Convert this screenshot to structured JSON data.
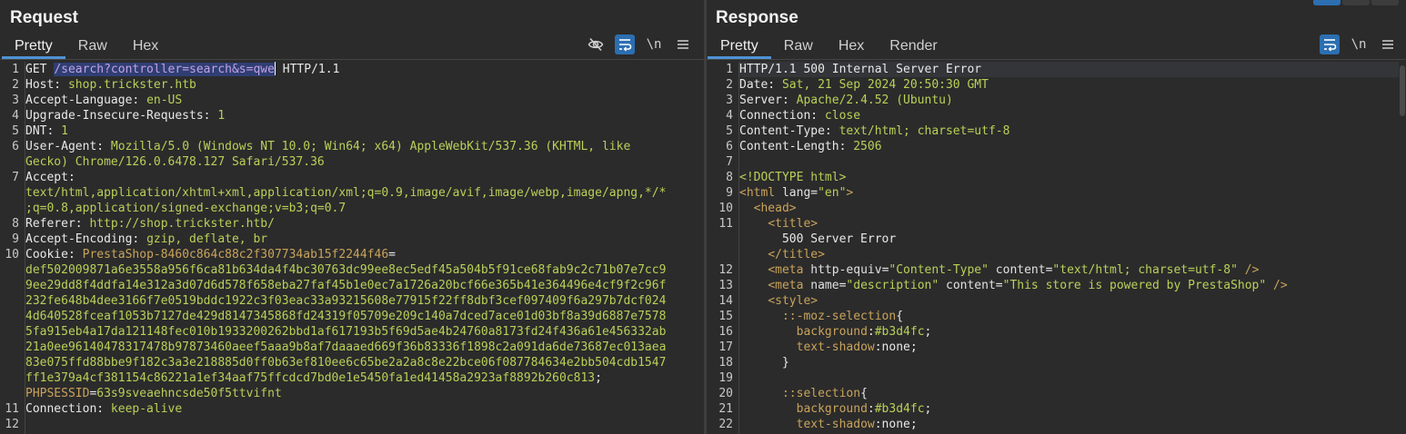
{
  "request": {
    "title": "Request",
    "tabs": [
      "Pretty",
      "Raw",
      "Hex"
    ],
    "active_tab": "Pretty",
    "tools": {
      "hide_icon": "eye-slash-icon",
      "wrap_icon": "wrap-lines-icon",
      "newline_label": "\\n",
      "menu_icon": "hamburger-menu-icon"
    },
    "line_numbers": [
      "1",
      "2",
      "3",
      "4",
      "5",
      "6",
      "",
      "7",
      "",
      "",
      "8",
      "9",
      "10",
      "",
      "",
      "",
      "",
      "",
      "",
      "",
      "",
      "",
      "11",
      "12"
    ],
    "lines": [
      [
        {
          "c": "k",
          "t": "GET "
        },
        {
          "c": "hl",
          "t": "/search?controller=search&s=qwe"
        },
        {
          "c": "caret",
          "t": ""
        },
        {
          "c": "k",
          "t": " HTTP/1.1"
        }
      ],
      [
        {
          "c": "k",
          "t": "Host: "
        },
        {
          "c": "v",
          "t": "shop.trickster.htb"
        }
      ],
      [
        {
          "c": "k",
          "t": "Accept-Language: "
        },
        {
          "c": "v",
          "t": "en-US"
        }
      ],
      [
        {
          "c": "k",
          "t": "Upgrade-Insecure-Requests: "
        },
        {
          "c": "v",
          "t": "1"
        }
      ],
      [
        {
          "c": "k",
          "t": "DNT: "
        },
        {
          "c": "v",
          "t": "1"
        }
      ],
      [
        {
          "c": "k",
          "t": "User-Agent: "
        },
        {
          "c": "v",
          "t": "Mozilla/5.0 (Windows NT 10.0; Win64; x64) AppleWebKit/537.36 (KHTML, like"
        }
      ],
      [
        {
          "c": "v",
          "t": "Gecko) Chrome/126.0.6478.127 Safari/537.36"
        }
      ],
      [
        {
          "c": "k",
          "t": "Accept:"
        }
      ],
      [
        {
          "c": "v",
          "t": "text/html,application/xhtml+xml,application/xml;q=0.9,image/avif,image/webp,image/apng,*/*"
        }
      ],
      [
        {
          "c": "v",
          "t": ";q=0.8,application/signed-exchange;v=b3;q=0.7"
        }
      ],
      [
        {
          "c": "k",
          "t": "Referer: "
        },
        {
          "c": "v",
          "t": "http://shop.trickster.htb/"
        }
      ],
      [
        {
          "c": "k",
          "t": "Accept-Encoding: "
        },
        {
          "c": "v",
          "t": "gzip, deflate, br"
        }
      ],
      [
        {
          "c": "k",
          "t": "Cookie: "
        },
        {
          "c": "t",
          "t": "PrestaShop-8460c864c88c2f307734ab15f2244f46"
        },
        {
          "c": "k",
          "t": "="
        }
      ],
      [
        {
          "c": "s",
          "t": "def502009871a6e3558a956f6ca81b634da4f4bc30763dc99ee8ec5edf45a504b5f91ce68fab9c2c71b07e7cc9"
        }
      ],
      [
        {
          "c": "s",
          "t": "9ee29dd8f4ddfa14e312a3d07d6d578f658eba27faf45b1e0ec7a1726a20bcf66e365b41e364496e4cf9f2c96f"
        }
      ],
      [
        {
          "c": "s",
          "t": "232fe648b4dee3166f7e0519bddc1922c3f03eac33a93215608e77915f22ff8dbf3cef097409f6a297b7dcf024"
        }
      ],
      [
        {
          "c": "s",
          "t": "4d640528fceaf1053b7127de429d8147345868fd24319f05709e209c140a7dced7ace01d03bf8a39d6887e7578"
        }
      ],
      [
        {
          "c": "s",
          "t": "5fa915eb4a17da121148fec010b1933200262bbd1af617193b5f69d5ae4b24760a8173fd24f436a61e456332ab"
        }
      ],
      [
        {
          "c": "s",
          "t": "21a0ee96140478317478b97873460aeef5aaa9b8af7daaaed669f36b83336f1898c2a091da6de73687ec013aea"
        }
      ],
      [
        {
          "c": "s",
          "t": "83e075ffd88bbe9f182c3a3e218885d0ff0b63ef810ee6c65be2a2a8c8e22bce06f087784634e2bb504cdb1547"
        }
      ],
      [
        {
          "c": "s",
          "t": "ff1e379a4cf381154c86221a1ef34aaf75ffcdcd7bd0e1e5450fa1ed41458a2923af8892b260c813"
        },
        {
          "c": "k",
          "t": ";"
        }
      ],
      [
        {
          "c": "t",
          "t": "PHPSESSID"
        },
        {
          "c": "k",
          "t": "="
        },
        {
          "c": "s",
          "t": "63s9sveaehncsde50f5ttvifnt"
        }
      ],
      [
        {
          "c": "k",
          "t": "Connection: "
        },
        {
          "c": "v",
          "t": "keep-alive"
        }
      ],
      []
    ]
  },
  "response": {
    "title": "Response",
    "tabs": [
      "Pretty",
      "Raw",
      "Hex",
      "Render"
    ],
    "active_tab": "Pretty",
    "tools": {
      "wrap_icon": "wrap-lines-icon",
      "newline_label": "\\n",
      "menu_icon": "hamburger-menu-icon"
    },
    "line_numbers": [
      "1",
      "2",
      "3",
      "4",
      "5",
      "6",
      "7",
      "8",
      "9",
      "10",
      "11",
      "",
      "",
      "12",
      "13",
      "14",
      "15",
      "16",
      "17",
      "18",
      "19",
      "20",
      "21",
      "22"
    ],
    "lines": [
      [
        {
          "c": "k",
          "t": "HTTP/1.1 500 Internal Server Error"
        }
      ],
      [
        {
          "c": "k",
          "t": "Date: "
        },
        {
          "c": "v",
          "t": "Sat, 21 Sep 2024 20:50:30 GMT"
        }
      ],
      [
        {
          "c": "k",
          "t": "Server: "
        },
        {
          "c": "v",
          "t": "Apache/2.4.52 (Ubuntu)"
        }
      ],
      [
        {
          "c": "k",
          "t": "Connection: "
        },
        {
          "c": "v",
          "t": "close"
        }
      ],
      [
        {
          "c": "k",
          "t": "Content-Type: "
        },
        {
          "c": "v",
          "t": "text/html; charset=utf-8"
        }
      ],
      [
        {
          "c": "k",
          "t": "Content-Length: "
        },
        {
          "c": "v",
          "t": "2506"
        }
      ],
      [],
      [
        {
          "c": "v",
          "t": "<!DOCTYPE html>"
        }
      ],
      [
        {
          "c": "t",
          "t": "<html "
        },
        {
          "c": "a",
          "t": "lang"
        },
        {
          "c": "k",
          "t": "="
        },
        {
          "c": "s",
          "t": "\"en\""
        },
        {
          "c": "t",
          "t": ">"
        }
      ],
      [
        {
          "c": "k",
          "t": "  "
        },
        {
          "c": "t",
          "t": "<head>"
        }
      ],
      [
        {
          "c": "k",
          "t": "    "
        },
        {
          "c": "t",
          "t": "<title>"
        }
      ],
      [
        {
          "c": "k",
          "t": "      500 Server Error"
        }
      ],
      [
        {
          "c": "k",
          "t": "    "
        },
        {
          "c": "t",
          "t": "</title>"
        }
      ],
      [
        {
          "c": "k",
          "t": "    "
        },
        {
          "c": "t",
          "t": "<meta "
        },
        {
          "c": "a",
          "t": "http-equiv"
        },
        {
          "c": "k",
          "t": "="
        },
        {
          "c": "s",
          "t": "\"Content-Type\""
        },
        {
          "c": "a",
          "t": " content"
        },
        {
          "c": "k",
          "t": "="
        },
        {
          "c": "s",
          "t": "\"text/html; charset=utf-8\""
        },
        {
          "c": "t",
          "t": " />"
        }
      ],
      [
        {
          "c": "k",
          "t": "    "
        },
        {
          "c": "t",
          "t": "<meta "
        },
        {
          "c": "a",
          "t": "name"
        },
        {
          "c": "k",
          "t": "="
        },
        {
          "c": "s",
          "t": "\"description\""
        },
        {
          "c": "a",
          "t": " content"
        },
        {
          "c": "k",
          "t": "="
        },
        {
          "c": "s",
          "t": "\"This store is powered by PrestaShop\""
        },
        {
          "c": "t",
          "t": " />"
        }
      ],
      [
        {
          "c": "k",
          "t": "    "
        },
        {
          "c": "t",
          "t": "<style>"
        }
      ],
      [
        {
          "c": "k",
          "t": "      "
        },
        {
          "c": "t",
          "t": "::-moz-selection"
        },
        {
          "c": "k",
          "t": "{"
        }
      ],
      [
        {
          "c": "k",
          "t": "        "
        },
        {
          "c": "t",
          "t": "background"
        },
        {
          "c": "k",
          "t": ":"
        },
        {
          "c": "s",
          "t": "#b3d4fc"
        },
        {
          "c": "k",
          "t": ";"
        }
      ],
      [
        {
          "c": "k",
          "t": "        "
        },
        {
          "c": "t",
          "t": "text-shadow"
        },
        {
          "c": "k",
          "t": ":none;"
        }
      ],
      [
        {
          "c": "k",
          "t": "      }"
        }
      ],
      [],
      [
        {
          "c": "k",
          "t": "      "
        },
        {
          "c": "t",
          "t": "::selection"
        },
        {
          "c": "k",
          "t": "{"
        }
      ],
      [
        {
          "c": "k",
          "t": "        "
        },
        {
          "c": "t",
          "t": "background"
        },
        {
          "c": "k",
          "t": ":"
        },
        {
          "c": "s",
          "t": "#b3d4fc"
        },
        {
          "c": "k",
          "t": ";"
        }
      ],
      [
        {
          "c": "k",
          "t": "        "
        },
        {
          "c": "t",
          "t": "text-shadow"
        },
        {
          "c": "k",
          "t": ":none;"
        }
      ]
    ]
  }
}
